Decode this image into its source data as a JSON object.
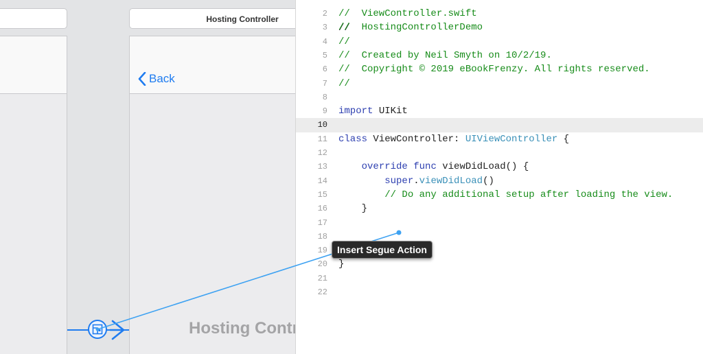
{
  "storyboard": {
    "hosting_scene_title": "Hosting Controller",
    "back_label": "Back",
    "hosting_placeholder": "Hosting Controller"
  },
  "editor": {
    "current_line": 10,
    "lines": [
      {
        "n": "2",
        "code": "//  ViewController.swift"
      },
      {
        "n": "3",
        "code": "//  HostingControllerDemo"
      },
      {
        "n": "4",
        "code": "//"
      },
      {
        "n": "5",
        "code": "//  Created by Neil Smyth on 10/2/19."
      },
      {
        "n": "6",
        "code": "//  Copyright © 2019 eBookFrenzy. All rights reserved."
      },
      {
        "n": "7",
        "code": "//"
      },
      {
        "n": "8",
        "code": ""
      },
      {
        "n": "9",
        "code": "import UIKit"
      },
      {
        "n": "10",
        "code": ""
      },
      {
        "n": "11",
        "code": "class ViewController: UIViewController {"
      },
      {
        "n": "12",
        "code": ""
      },
      {
        "n": "13",
        "code": "    override func viewDidLoad() {"
      },
      {
        "n": "14",
        "code": "        super.viewDidLoad()"
      },
      {
        "n": "15",
        "code": "        // Do any additional setup after loading the view."
      },
      {
        "n": "16",
        "code": "    }"
      },
      {
        "n": "17",
        "code": ""
      },
      {
        "n": "18",
        "code": ""
      },
      {
        "n": "19",
        "code": ""
      },
      {
        "n": "20",
        "code": "}"
      },
      {
        "n": "21",
        "code": ""
      },
      {
        "n": "22",
        "code": ""
      }
    ]
  },
  "tooltip": {
    "label": "Insert Segue Action"
  },
  "colors": {
    "accent": "#1f7cf0",
    "comment": "#178c1a",
    "keyword": "#9b2393",
    "type": "#3a90b8"
  }
}
